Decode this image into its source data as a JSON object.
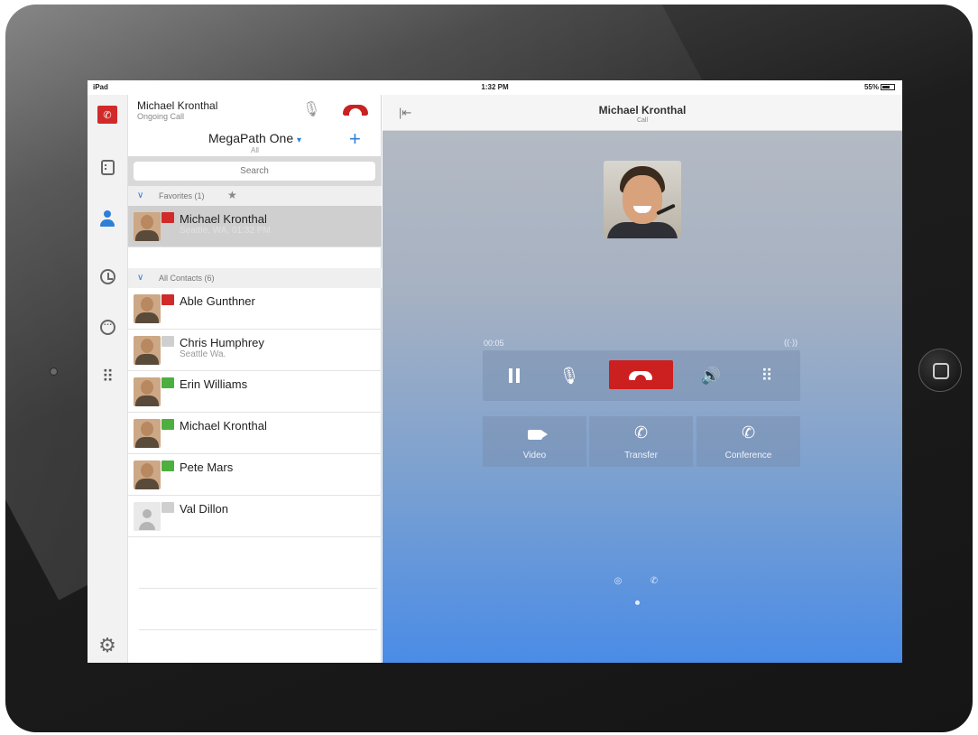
{
  "status_bar": {
    "carrier": "iPad",
    "time": "1:32 PM",
    "battery": "55%"
  },
  "ongoing_call": {
    "name": "Michael Kronthal",
    "status": "Ongoing Call"
  },
  "account": {
    "name": "MegaPath One",
    "filter": "All"
  },
  "search": {
    "placeholder": "Search"
  },
  "sections": {
    "favorites": "Favorites (1)",
    "all_contacts": "All Contacts (6)"
  },
  "favorites": [
    {
      "name": "Michael Kronthal",
      "location": "Seattle, WA, 01:32 PM",
      "status_color": "#d12a2a"
    }
  ],
  "contacts": [
    {
      "name": "Able Gunthner",
      "location": "",
      "status_color": "#d12a2a"
    },
    {
      "name": "Chris Humphrey",
      "location": "Seattle Wa.",
      "status_color": "#cfcfcf"
    },
    {
      "name": "Erin Williams",
      "location": "",
      "status_color": "#4caf3f"
    },
    {
      "name": "Michael Kronthal",
      "location": "",
      "status_color": "#4caf3f"
    },
    {
      "name": "Pete Mars",
      "location": "",
      "status_color": "#4caf3f"
    },
    {
      "name": "Val Dillon",
      "location": "",
      "status_color": "#cfcfcf"
    }
  ],
  "call": {
    "contact_name": "Michael Kronthal",
    "subtitle": "Call",
    "timer": "00:05",
    "actions": {
      "video": "Video",
      "transfer": "Transfer",
      "conference": "Conference"
    }
  },
  "colors": {
    "accent": "#2f7fd6",
    "hangup": "#cc1f1f",
    "presence_busy": "#d12a2a",
    "presence_available": "#4caf3f"
  },
  "icons": {
    "rail": [
      "flag-icon",
      "building-icon",
      "person-icon",
      "history-icon",
      "chat-icon",
      "dialpad-icon",
      "gear-icon"
    ],
    "controls": [
      "pause-icon",
      "mute-icon",
      "hangup-icon",
      "speaker-icon",
      "keypad-icon"
    ]
  }
}
